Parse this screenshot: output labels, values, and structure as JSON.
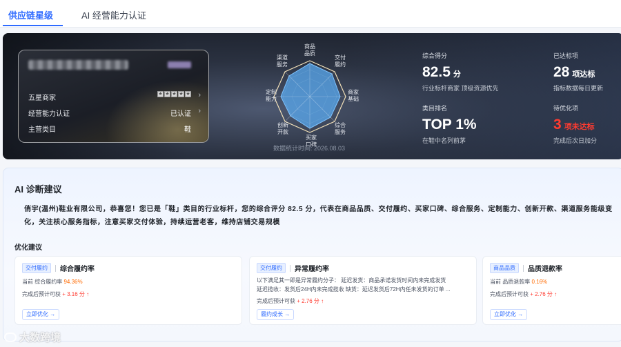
{
  "tabs": [
    {
      "label": "供应链星级",
      "active": true
    },
    {
      "label": "AI 经营能力认证",
      "active": false
    }
  ],
  "merchant_card": {
    "rows": [
      {
        "label": "五星商家",
        "value": "",
        "stars": 5
      },
      {
        "label": "经营能力认证",
        "value": "已认证"
      },
      {
        "label": "主营类目",
        "value": "鞋"
      }
    ]
  },
  "radar": {
    "axes": [
      "商品\n品质",
      "交付\n履约",
      "商家\n基础",
      "综合\n服务",
      "买家\n口碑",
      "创新\n开款",
      "定制\n能力",
      "渠道\n服务"
    ],
    "stat_time": "数据统计时间: 2026.08.03"
  },
  "stats": {
    "score": {
      "label": "综合得分",
      "value": "82.5",
      "unit": "分",
      "sub": "行业标杆商家 顶级资源优先"
    },
    "reached": {
      "label": "已达标项",
      "value": "28",
      "unit": "项达标",
      "sub": "指标数据每日更新"
    },
    "rank": {
      "label": "类目排名",
      "value": "TOP 1%",
      "sub": "在鞋中名列前茅"
    },
    "pending": {
      "label": "待优化项",
      "value": "3",
      "unit": "项未达标",
      "sub": "完成后次日加分"
    }
  },
  "ai": {
    "title": "AI 诊断建议",
    "diagnosis": "俏宇(温州)鞋业有限公司，恭喜您！您已是「鞋」类目的行业标杆，您的综合评分 82.5 分，代表在商品品质、交付履约、买家口碑、综合服务、定制能力、创新开款、渠道服务能级变化，关注核心服务指标，注意买家交付体验，持续运营老客，维持店铺交易规模",
    "optimize_title": "优化建议",
    "suggestions": [
      {
        "tag": "交付履约",
        "name": "综合履约率",
        "line1_prefix": "当前 综合履约率 ",
        "line1_value": "94.36%",
        "line2_prefix": "完成后预计可获 ",
        "line2_value": "+ 3.16 分 ↑",
        "button": "立即优化 →"
      },
      {
        "tag": "交付履约",
        "name": "异常履约率",
        "desc1": "以下满足其一即是异常履约分子：   延迟发货：商品承诺发货时间内未完成发货",
        "desc2": "延迟揽收：发货后24H内未完成揽收 缺货：延迟发货后72H内任未发货的订单 ...",
        "line2_prefix": "完成后预计可获 ",
        "line2_value": "+ 2.76 分 ↑",
        "button": "履约成长 →"
      },
      {
        "tag": "商品品质",
        "name": "品质退款率",
        "line1_prefix": "当前 品质退款率 ",
        "line1_value": "0.16%",
        "line2_prefix": "完成后预计可获 ",
        "line2_value": "+ 2.76 分 ↑",
        "button": "立即优化 →"
      }
    ]
  },
  "watermark": "大数跨境",
  "colors": {
    "accent": "#2f6bff",
    "alert": "#ff3b30",
    "highlight": "#ff6a00"
  }
}
